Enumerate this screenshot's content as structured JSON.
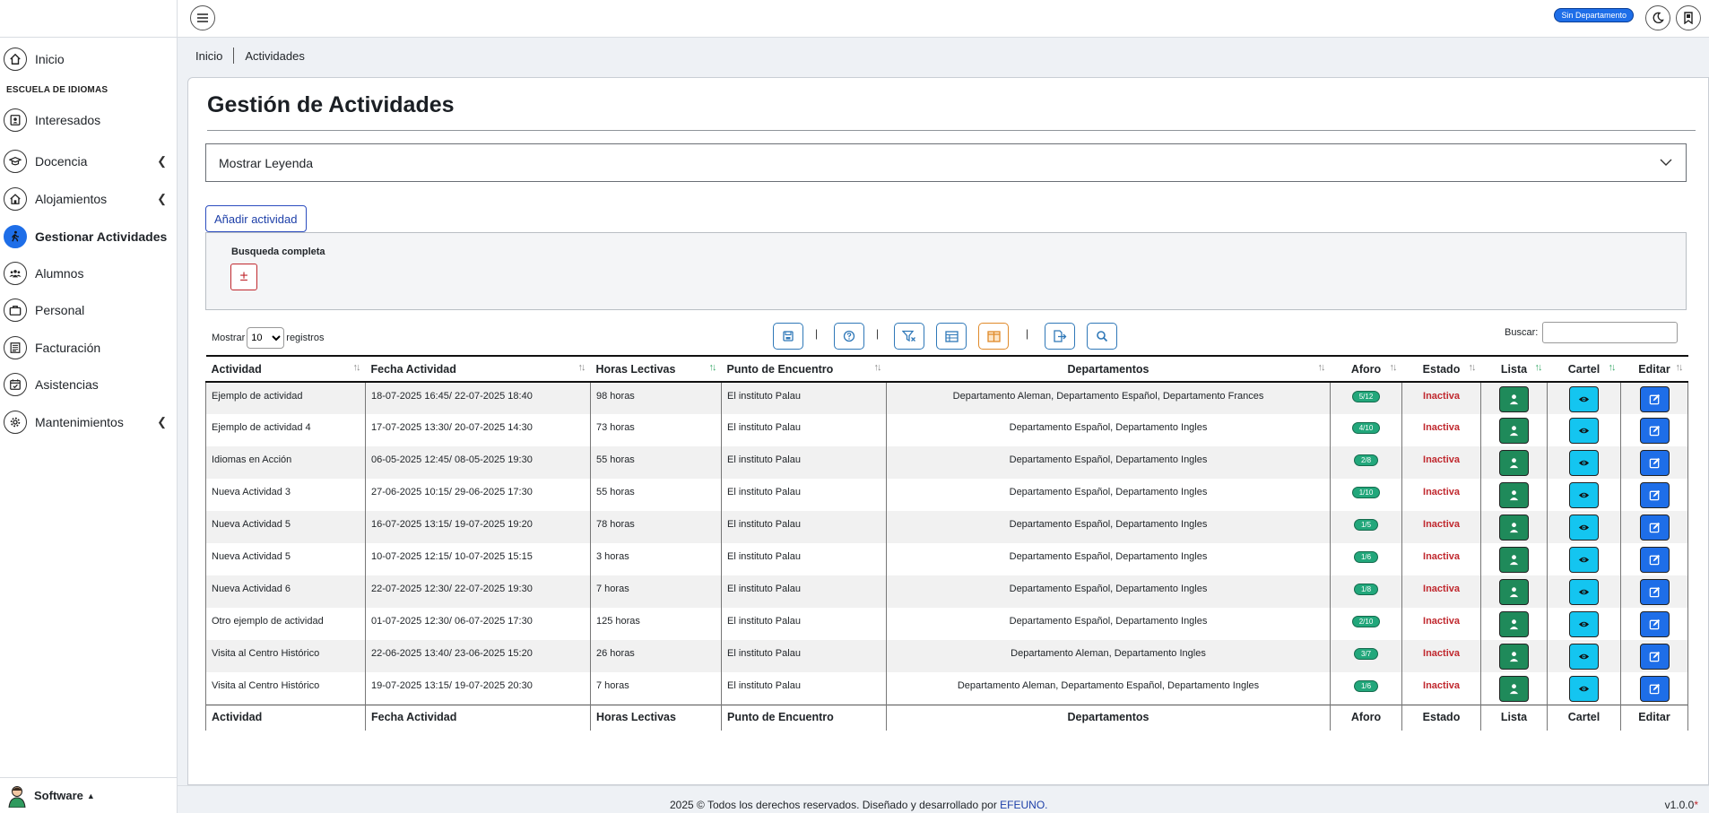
{
  "sidebar": {
    "home": "Inicio",
    "section": "ESCUELA DE IDIOMAS",
    "items": [
      {
        "label": "Interesados",
        "icon": "contact-card-icon"
      },
      {
        "label": "Docencia",
        "icon": "graduation-cap-icon"
      },
      {
        "label": "Alojamientos",
        "icon": "house-icon"
      },
      {
        "label": "Gestionar Actividades",
        "icon": "person-walking-icon"
      },
      {
        "label": "Alumnos",
        "icon": "people-group-icon"
      },
      {
        "label": "Personal",
        "icon": "briefcase-icon"
      },
      {
        "label": "Facturación",
        "icon": "invoice-icon"
      },
      {
        "label": "Asistencias",
        "icon": "calendar-check-icon"
      },
      {
        "label": "Mantenimientos",
        "icon": "gear-icon"
      }
    ],
    "footer_label": "Software",
    "active_color": "#1e6ee8"
  },
  "topbar": {
    "dept_badge": "Sin Departamento"
  },
  "breadcrumb": {
    "home": "Inicio",
    "current": "Actividades"
  },
  "page": {
    "title": "Gestión de Actividades",
    "legend_toggle": "Mostrar Leyenda",
    "add_button": "Añadir actividad",
    "full_search_label": "Busqueda completa",
    "full_search_toggle": "±"
  },
  "table_controls": {
    "show_prefix": "Mostrar",
    "show_value": "10",
    "show_suffix": "registros",
    "search_label": "Buscar:",
    "search_value": ""
  },
  "table": {
    "headers": [
      "Actividad",
      "Fecha Actividad",
      "Horas Lectivas",
      "Punto de Encuentro",
      "Departamentos",
      "Aforo",
      "Estado",
      "Lista",
      "Cartel",
      "Editar"
    ],
    "rows": [
      [
        "Ejemplo de actividad",
        "18-07-2025 16:45/ 22-07-2025 18:40",
        "98 horas",
        "El instituto Palau",
        "Departamento Aleman, Departamento Español, Departamento Frances",
        "5/12",
        "Inactiva"
      ],
      [
        "Ejemplo de actividad 4",
        "17-07-2025 13:30/ 20-07-2025 14:30",
        "73 horas",
        "El instituto Palau",
        "Departamento Español, Departamento Ingles",
        "4/10",
        "Inactiva"
      ],
      [
        "Idiomas en Acción",
        "06-05-2025 12:45/ 08-05-2025 19:30",
        "55 horas",
        "El instituto Palau",
        "Departamento Español, Departamento Ingles",
        "2/8",
        "Inactiva"
      ],
      [
        "Nueva Actividad 3",
        "27-06-2025 10:15/ 29-06-2025 17:30",
        "55 horas",
        "El instituto Palau",
        "Departamento Español, Departamento Ingles",
        "1/10",
        "Inactiva"
      ],
      [
        "Nueva Actividad 5",
        "16-07-2025 13:15/ 19-07-2025 19:20",
        "78 horas",
        "El instituto Palau",
        "Departamento Español, Departamento Ingles",
        "1/5",
        "Inactiva"
      ],
      [
        "Nueva Actividad 5",
        "10-07-2025 12:15/ 10-07-2025 15:15",
        "3 horas",
        "El instituto Palau",
        "Departamento Español, Departamento Ingles",
        "1/6",
        "Inactiva"
      ],
      [
        "Nueva Actividad 6",
        "22-07-2025 12:30/ 22-07-2025 19:30",
        "7 horas",
        "El instituto Palau",
        "Departamento Español, Departamento Ingles",
        "1/8",
        "Inactiva"
      ],
      [
        "Otro ejemplo de actividad",
        "01-07-2025 12:30/ 06-07-2025 17:30",
        "125 horas",
        "El instituto Palau",
        "Departamento Español, Departamento Ingles",
        "2/10",
        "Inactiva"
      ],
      [
        "Visita al Centro Histórico",
        "22-06-2025 13:40/ 23-06-2025 15:20",
        "26 horas",
        "El instituto Palau",
        "Departamento Aleman, Departamento Ingles",
        "3/7",
        "Inactiva"
      ],
      [
        "Visita al Centro Histórico",
        "19-07-2025 13:15/ 19-07-2025 20:30",
        "7 horas",
        "El instituto Palau",
        "Departamento Aleman, Departamento Español, Departamento Ingles",
        "1/6",
        "Inactiva"
      ]
    ],
    "status_color": "#c0282e",
    "aforo_color": "#22a77b"
  },
  "footer": {
    "copyright": "2025 © Todos los derechos reservados. Diseñado y desarrollado por ",
    "brand": "EFEUNO.",
    "version": "v1.0.0",
    "version_mark": "*"
  }
}
